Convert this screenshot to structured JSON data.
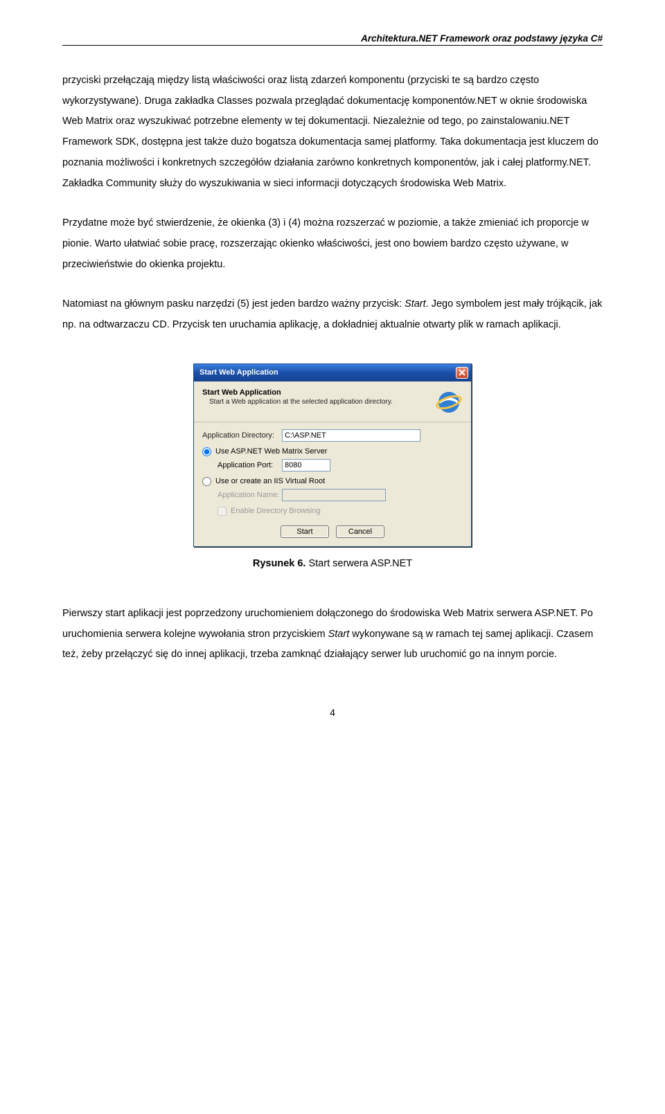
{
  "header": "Architektura.NET Framework oraz podstawy języka C#",
  "para1": "przyciski przełączają między listą właściwości oraz listą zdarzeń komponentu (przyciski te są bardzo często wykorzystywane). Druga zakładka Classes pozwala przeglądać dokumentację komponentów.NET w oknie środowiska Web Matrix oraz wyszukiwać potrzebne elementy w tej dokumentacji. Niezależnie od tego, po zainstalowaniu.NET Framework SDK, dostępna jest także dużo bogatsza dokumentacja samej platformy. Taka dokumentacja jest kluczem do poznania możliwości i konkretnych szczegółów działania zarówno konkretnych komponentów, jak i całej platformy.NET. Zakładka Community służy do wyszukiwania w sieci informacji dotyczących środowiska Web Matrix.",
  "para2": "Przydatne może być stwierdzenie, że okienka (3) i (4) można rozszerzać w poziomie, a także zmieniać ich proporcje w pionie. Warto ułatwiać sobie pracę, rozszerzając okienko właściwości, jest ono bowiem bardzo często używane, w przeciwieństwie do okienka projektu.",
  "para3_a": "Natomiast na głównym pasku narzędzi (5) jest jeden bardzo ważny przycisk: ",
  "para3_b": ". Jego symbolem jest mały trójkącik, jak np. na odtwarzaczu CD. Przycisk ten uruchamia aplikację, a dokładniej aktualnie otwarty plik w ramach aplikacji.",
  "para3_start": "Start",
  "dialog": {
    "title": "Start Web Application",
    "header": "Start Web Application",
    "sub": "Start a Web application at the selected application directory.",
    "appdir_label": "Application Directory:",
    "appdir_value": "C:\\ASP.NET",
    "radio_matrix": "Use ASP.NET Web Matrix Server",
    "port_label": "Application Port:",
    "port_value": "8080",
    "radio_iis": "Use or create an IIS Virtual Root",
    "appname_label": "Application Name:",
    "appname_value": "",
    "check_browse": "Enable Directory Browsing",
    "btn_start": "Start",
    "btn_cancel": "Cancel"
  },
  "caption_b": "Rysunek 6.",
  "caption_t": " Start serwera ASP.NET",
  "para4_a": "Pierwszy start aplikacji jest poprzedzony uruchomieniem dołączonego do środowiska Web Matrix serwera ASP.NET. Po uruchomienia serwera kolejne wywołania stron przyciskiem ",
  "para4_start": "Start",
  "para4_b": " wykonywane są w ramach tej samej aplikacji. Czasem też, żeby przełączyć się do innej aplikacji, trzeba zamknąć działający serwer lub uruchomić go na innym porcie.",
  "page_number": "4"
}
